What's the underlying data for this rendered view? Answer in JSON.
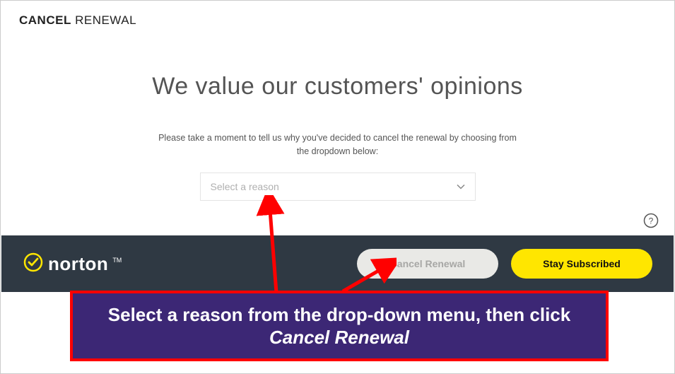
{
  "header": {
    "title_bold": "CANCEL",
    "title_light": "RENEWAL"
  },
  "main": {
    "heading": "We value our customers' opinions",
    "instruction": "Please take a moment to tell us why you've decided to cancel the renewal by choosing from the dropdown below:",
    "dropdown_placeholder": "Select a reason"
  },
  "footer": {
    "brand": "norton",
    "tm": "TM",
    "cancel_label": "Cancel Renewal",
    "stay_label": "Stay Subscribed"
  },
  "annotation": {
    "line_plain": "Select a reason from the drop-down menu, then click ",
    "line_italic": "Cancel Renewal"
  },
  "colors": {
    "accent_yellow": "#ffe600",
    "footer_bg": "#2f3943",
    "annotation_bg": "#3c2775",
    "annotation_border": "#ff0000"
  }
}
